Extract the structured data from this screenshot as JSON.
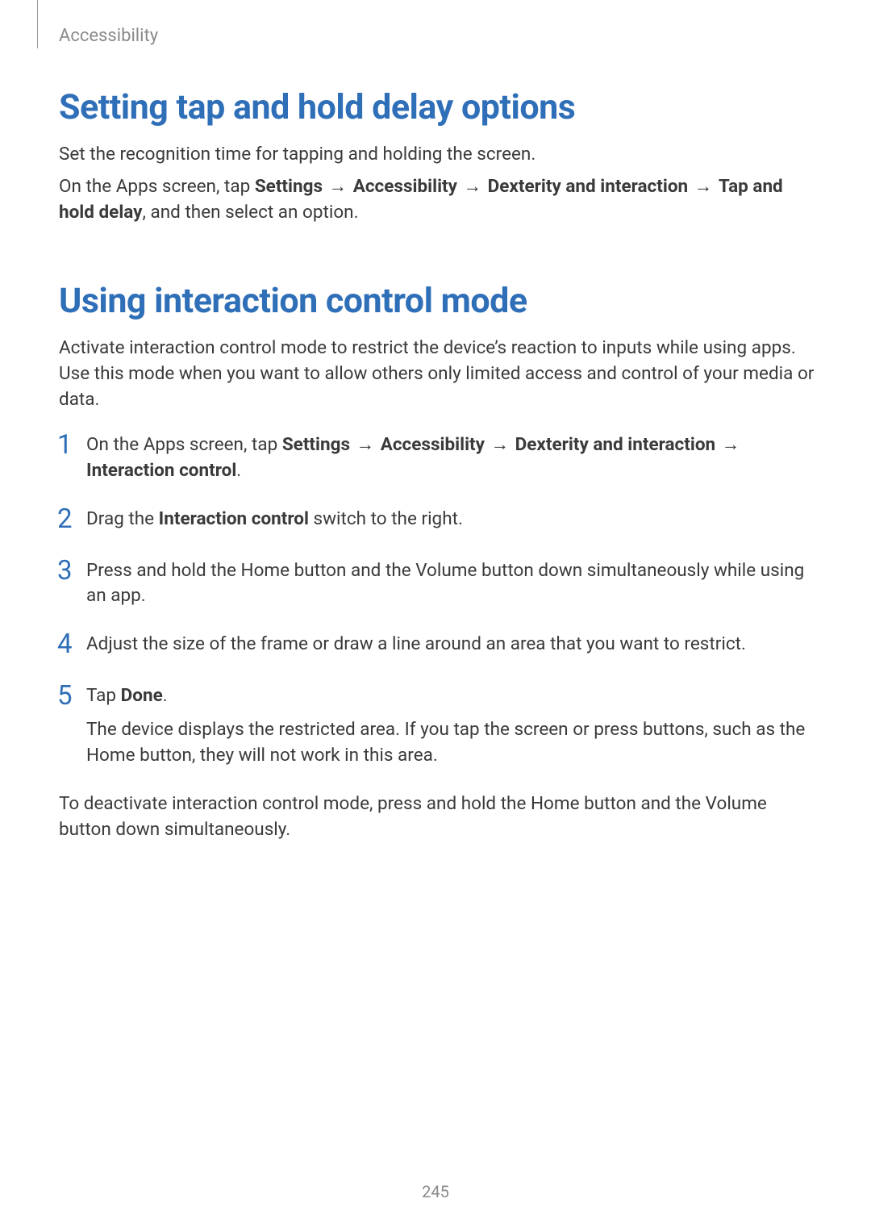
{
  "breadcrumb": "Accessibility",
  "section1": {
    "heading": "Setting tap and hold delay options",
    "intro": "Set the recognition time for tapping and holding the screen.",
    "path_prefix": "On the Apps screen, tap ",
    "path_parts": {
      "settings": "Settings",
      "accessibility": "Accessibility",
      "dexterity": "Dexterity and interaction",
      "tap_hold": "Tap and hold delay"
    },
    "path_suffix": ", and then select an option."
  },
  "section2": {
    "heading": "Using interaction control mode",
    "intro": "Activate interaction control mode to restrict the device’s reaction to inputs while using apps. Use this mode when you want to allow others only limited access and control of your media or data.",
    "steps": {
      "s1_prefix": "On the Apps screen, tap ",
      "s1_parts": {
        "settings": "Settings",
        "accessibility": "Accessibility",
        "dexterity": "Dexterity and interaction",
        "interaction": "Interaction control"
      },
      "s1_suffix": ".",
      "s2_pre": "Drag the ",
      "s2_bold": "Interaction control",
      "s2_post": " switch to the right.",
      "s3": "Press and hold the Home button and the Volume button down simultaneously while using an app.",
      "s4": "Adjust the size of the frame or draw a line around an area that you want to restrict.",
      "s5_pre": "Tap ",
      "s5_bold": "Done",
      "s5_post": ".",
      "s5_sub": "The device displays the restricted area. If you tap the screen or press buttons, such as the Home button, they will not work in this area."
    },
    "outro": "To deactivate interaction control mode, press and hold the Home button and the Volume button down simultaneously."
  },
  "arrow": "→",
  "page_number": "245"
}
